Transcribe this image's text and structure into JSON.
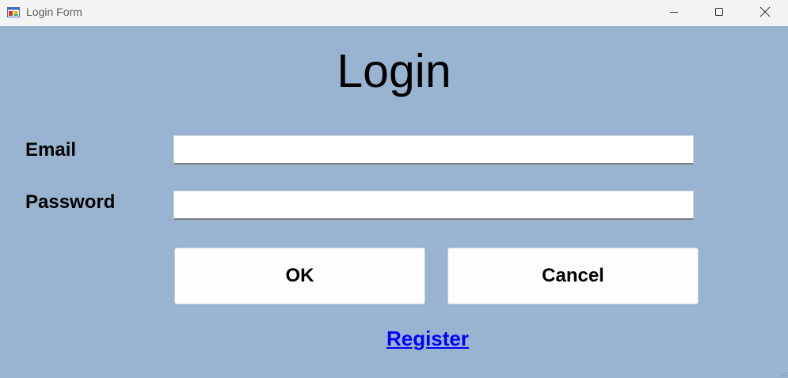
{
  "window": {
    "title": "Login Form",
    "background_color": "#99b4d1",
    "controls": {
      "minimize_icon": "minimize-icon",
      "maximize_icon": "maximize-icon",
      "close_icon": "close-icon"
    }
  },
  "form": {
    "heading": "Login",
    "email_label": "Email",
    "email_value": "",
    "password_label": "Password",
    "password_value": "",
    "ok_label": "OK",
    "cancel_label": "Cancel",
    "register_link": "Register",
    "link_color": "#0000ff"
  }
}
